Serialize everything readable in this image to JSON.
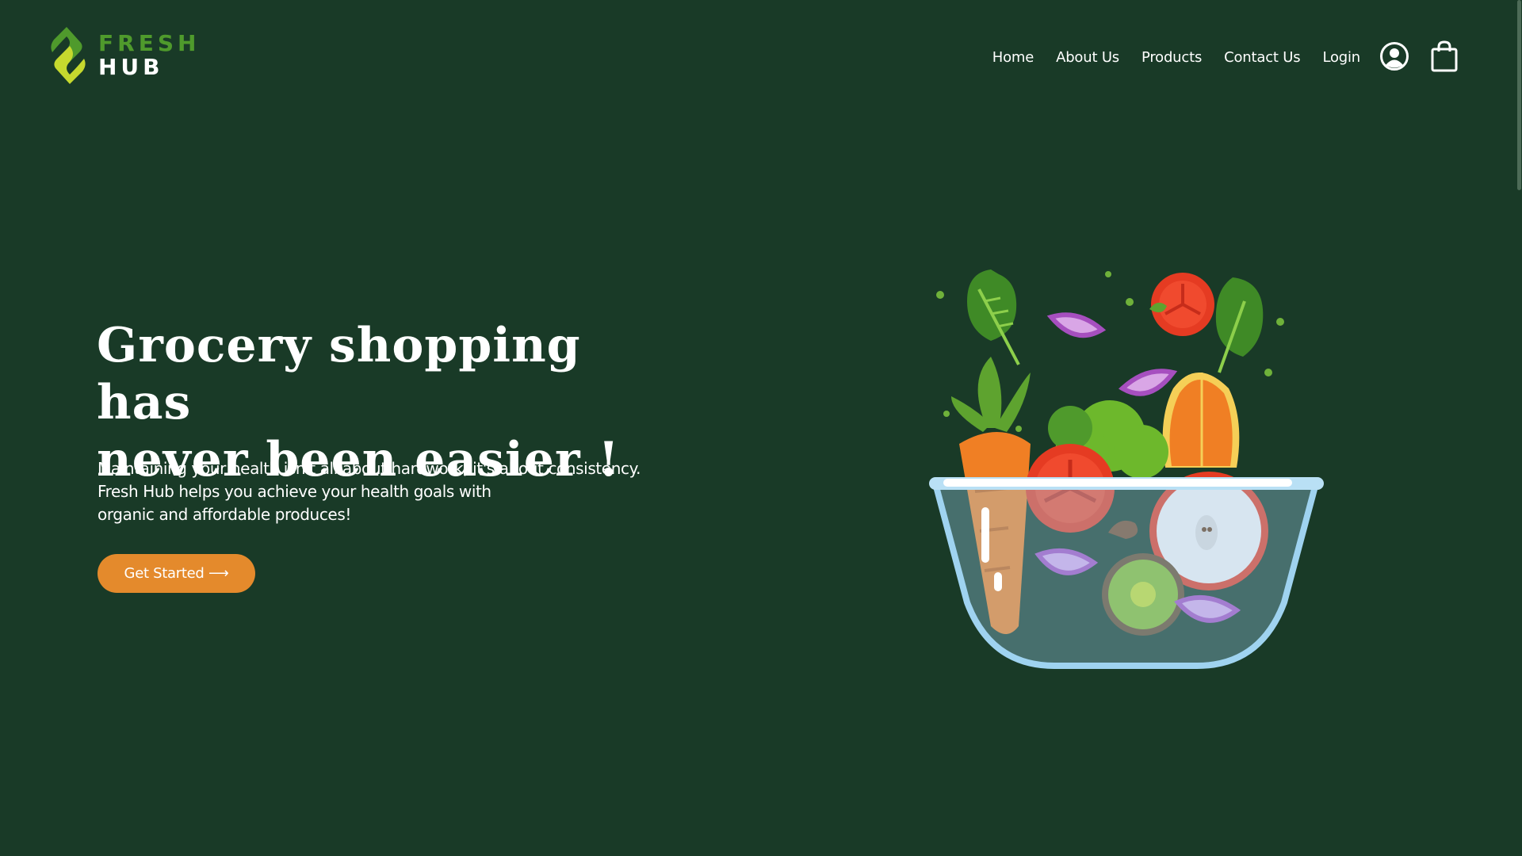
{
  "brand": {
    "name_line_1": "FRESH",
    "name_line_2": "HUB",
    "accent_color": "#4f9a2c",
    "mark_color_light": "#c6d92e",
    "mark_color_dark": "#4f9a2c"
  },
  "nav": {
    "items": [
      {
        "label": "Home"
      },
      {
        "label": "About Us"
      },
      {
        "label": "Products"
      },
      {
        "label": "Contact Us"
      },
      {
        "label": "Login"
      }
    ],
    "icons": [
      "account-icon",
      "shopping-bag-icon"
    ]
  },
  "hero": {
    "title_line_1": "Grocery shopping has",
    "title_line_2": "never been easier !",
    "subtitle_lines": [
      "Maintaining your health isn't all about hardwork, it's about consistency.",
      "Fresh Hub helps you achieve your health goals with",
      "organic and affordable produces!"
    ],
    "cta_label": "Get Started ⟶",
    "cta_color": "#e48a2c"
  },
  "theme": {
    "background": "#193a27",
    "text": "#ffffff"
  }
}
